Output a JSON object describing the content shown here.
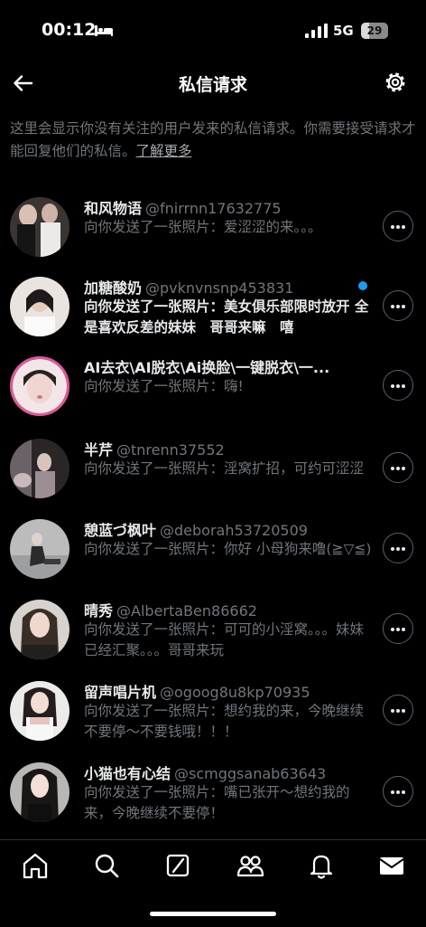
{
  "status_bar": {
    "time": "00:12",
    "network": "5G",
    "battery": "29",
    "battery_fraction": 0.29
  },
  "header": {
    "title": "私信请求"
  },
  "notice": {
    "text": "这里会显示你没有关注的用户发来的私信请求。你需要接受请求才能回复他们的私信。",
    "link": "了解更多"
  },
  "requests": [
    {
      "name": "和风物语",
      "handle": "@fnirrnn17632775",
      "message": "向你发送了一张照片：爱涩涩的来。。。",
      "unread": false
    },
    {
      "name": "加糖酸奶",
      "handle": "@pvknvnsnp453831",
      "message": "向你发送了一张照片：美女俱乐部限时放开 全是喜欢反差的妹妹　哥哥来嘛　嘻",
      "unread": true
    },
    {
      "name": "AI去衣\\AI脱衣\\Ai换脸\\一键脱衣\\一...",
      "handle": "",
      "message": "向你发送了一张照片：嗨!",
      "unread": false
    },
    {
      "name": "半芹",
      "handle": "@tnrenn37552",
      "message": "向你发送了一张照片：淫窝扩招，可约可涩涩",
      "unread": false
    },
    {
      "name": "憩蓝づ枫叶",
      "handle": "@deborah53720509",
      "message": "向你发送了一张照片：你好 小母狗来噜(≧▽≦)",
      "unread": false
    },
    {
      "name": "晴秀",
      "handle": "@AlbertaBen86662",
      "message": "向你发送了一张照片：可可的小淫窝。。。妹妹已经汇聚。。。哥哥来玩",
      "unread": false
    },
    {
      "name": "留声唱片机",
      "handle": "@ogoog8u8kp70935",
      "message": "向你发送了一张照片：想约我的来，今晚继续不要停～不要钱哦！！！",
      "unread": false
    },
    {
      "name": "小猫也有心结",
      "handle": "@scmggsanab63643",
      "message": "向你发送了一张照片：嘴已张开～想约我的来，今晚继续不要停！",
      "unread": false
    }
  ],
  "nav": [
    "home-icon",
    "search-icon",
    "grok-icon",
    "communities-icon",
    "notifications-icon",
    "messages-icon"
  ]
}
